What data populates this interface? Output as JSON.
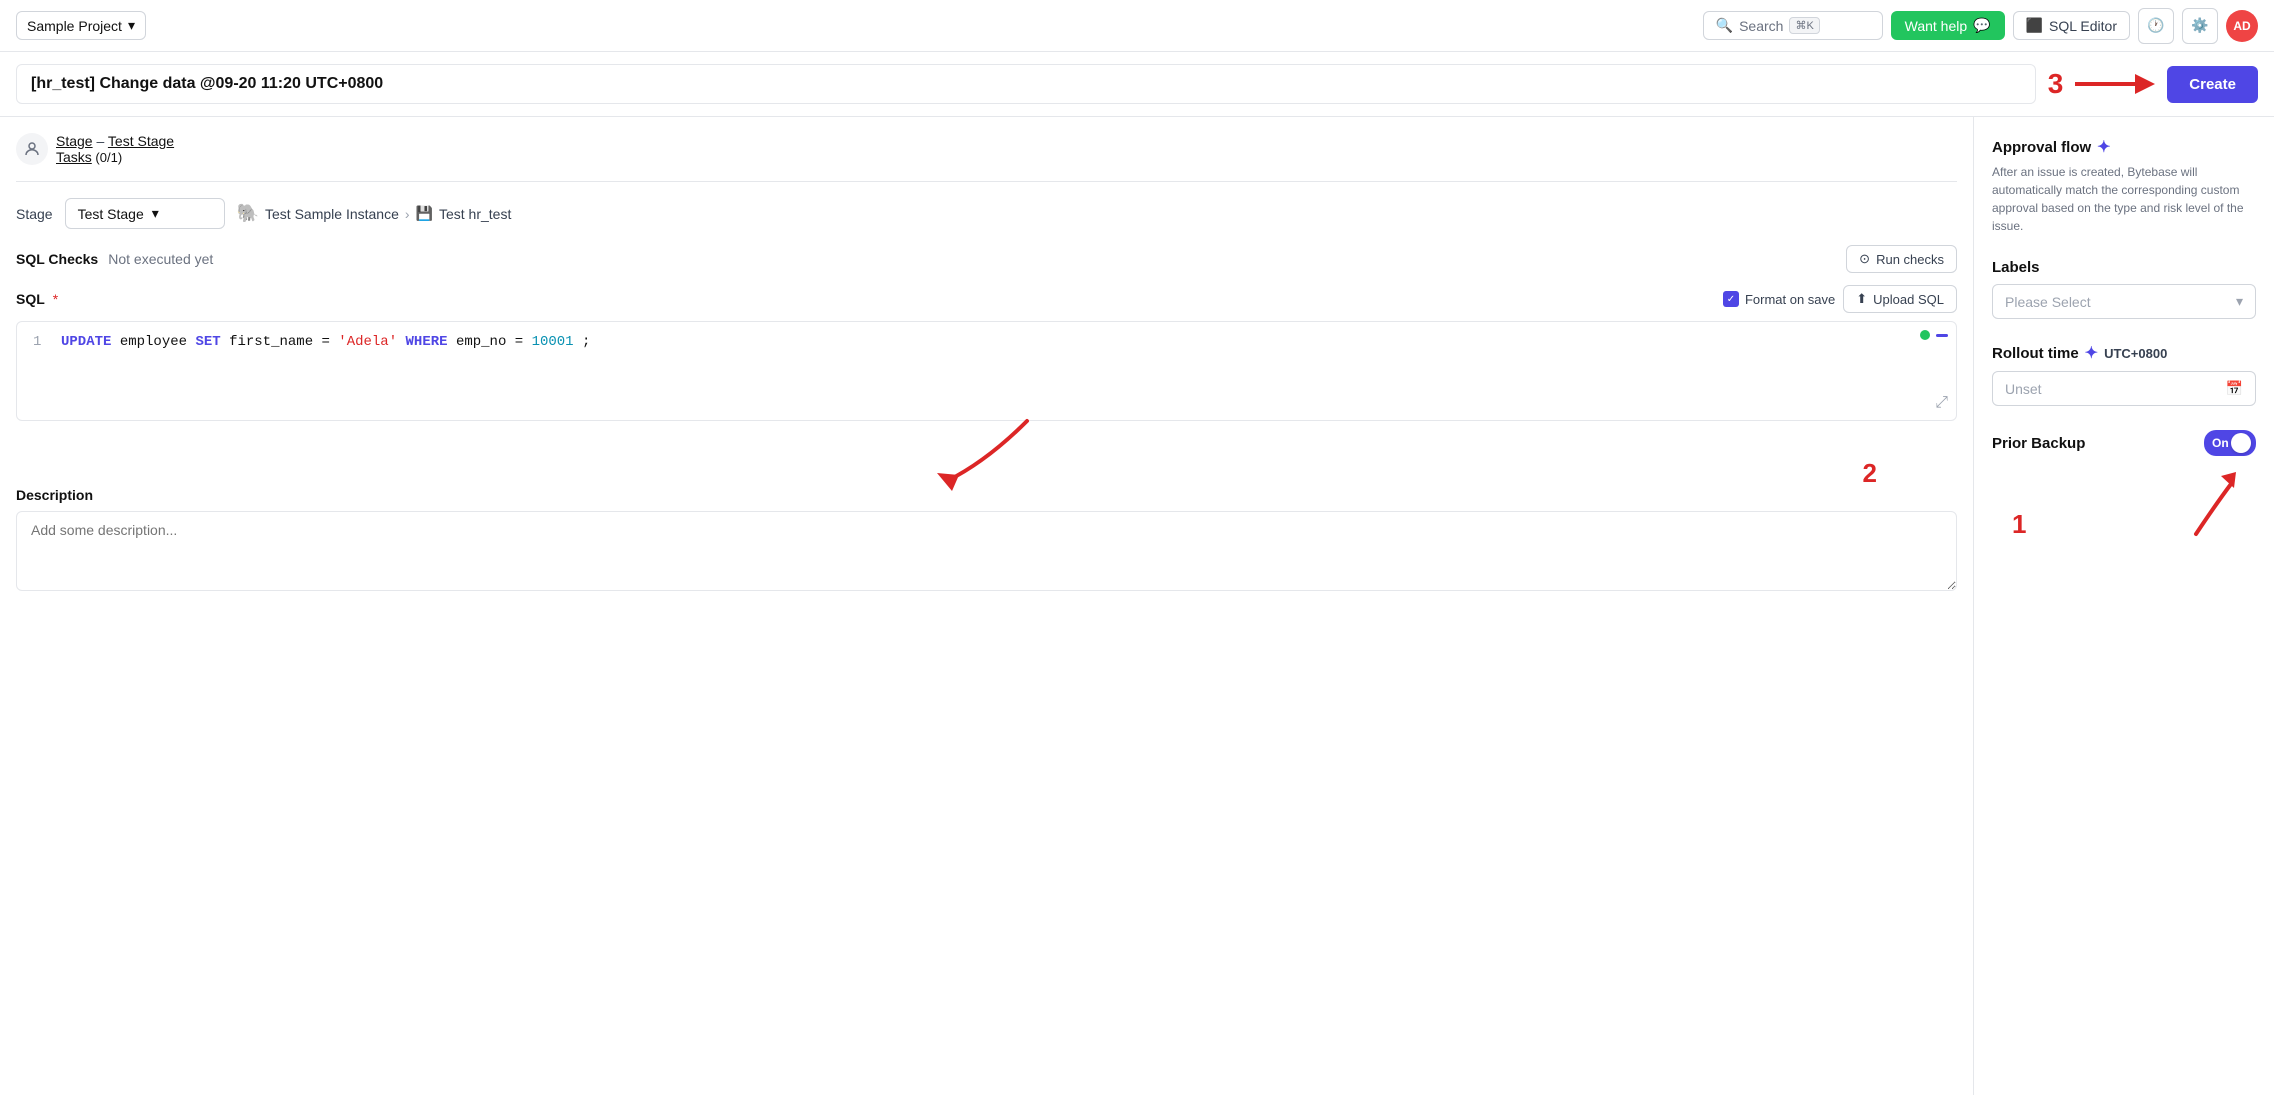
{
  "topnav": {
    "project_label": "Sample Project",
    "search_placeholder": "Search",
    "search_shortcut": "⌘K",
    "want_help_label": "Want help",
    "sql_editor_label": "SQL Editor",
    "avatar_initials": "AD"
  },
  "titlebar": {
    "issue_title": "[hr_test] Change data @09-20 11:20 UTC+0800",
    "create_label": "Create",
    "annotation_3": "3"
  },
  "sidebar": {
    "stage_link": "Stage",
    "test_stage_link": "Test Stage",
    "tasks_label": "Tasks",
    "tasks_progress": "(0/1)"
  },
  "stage_row": {
    "stage_label": "Stage",
    "stage_value": "Test Stage",
    "instance_label": "Test Sample Instance",
    "db_label": "Test hr_test"
  },
  "sql_checks": {
    "label": "SQL Checks",
    "status": "Not executed yet",
    "run_checks_label": "Run checks"
  },
  "sql_section": {
    "label": "SQL",
    "required": "*",
    "format_on_save_label": "Format on save",
    "upload_sql_label": "Upload SQL",
    "line_number": "1",
    "code_kw1": "UPDATE",
    "code_plain1": " employee ",
    "code_kw2": "SET",
    "code_plain2": " first_name = ",
    "code_str": "'Adela'",
    "code_plain3": " ",
    "code_kw3": "WHERE",
    "code_plain4": " emp_no = ",
    "code_num": "10001",
    "code_semi": ";"
  },
  "description": {
    "label": "Description",
    "placeholder": "Add some description..."
  },
  "right_panel": {
    "approval_flow_title": "Approval flow",
    "approval_flow_desc": "After an issue is created, Bytebase will automatically match the corresponding custom approval based on the type and risk level of the issue.",
    "labels_title": "Labels",
    "labels_placeholder": "Please Select",
    "rollout_title": "Rollout time",
    "rollout_timezone": "UTC+0800",
    "rollout_placeholder": "Unset",
    "prior_backup_label": "Prior Backup",
    "toggle_on_text": "On"
  },
  "annotations": {
    "num1": "1",
    "num2": "2",
    "num3": "3"
  }
}
